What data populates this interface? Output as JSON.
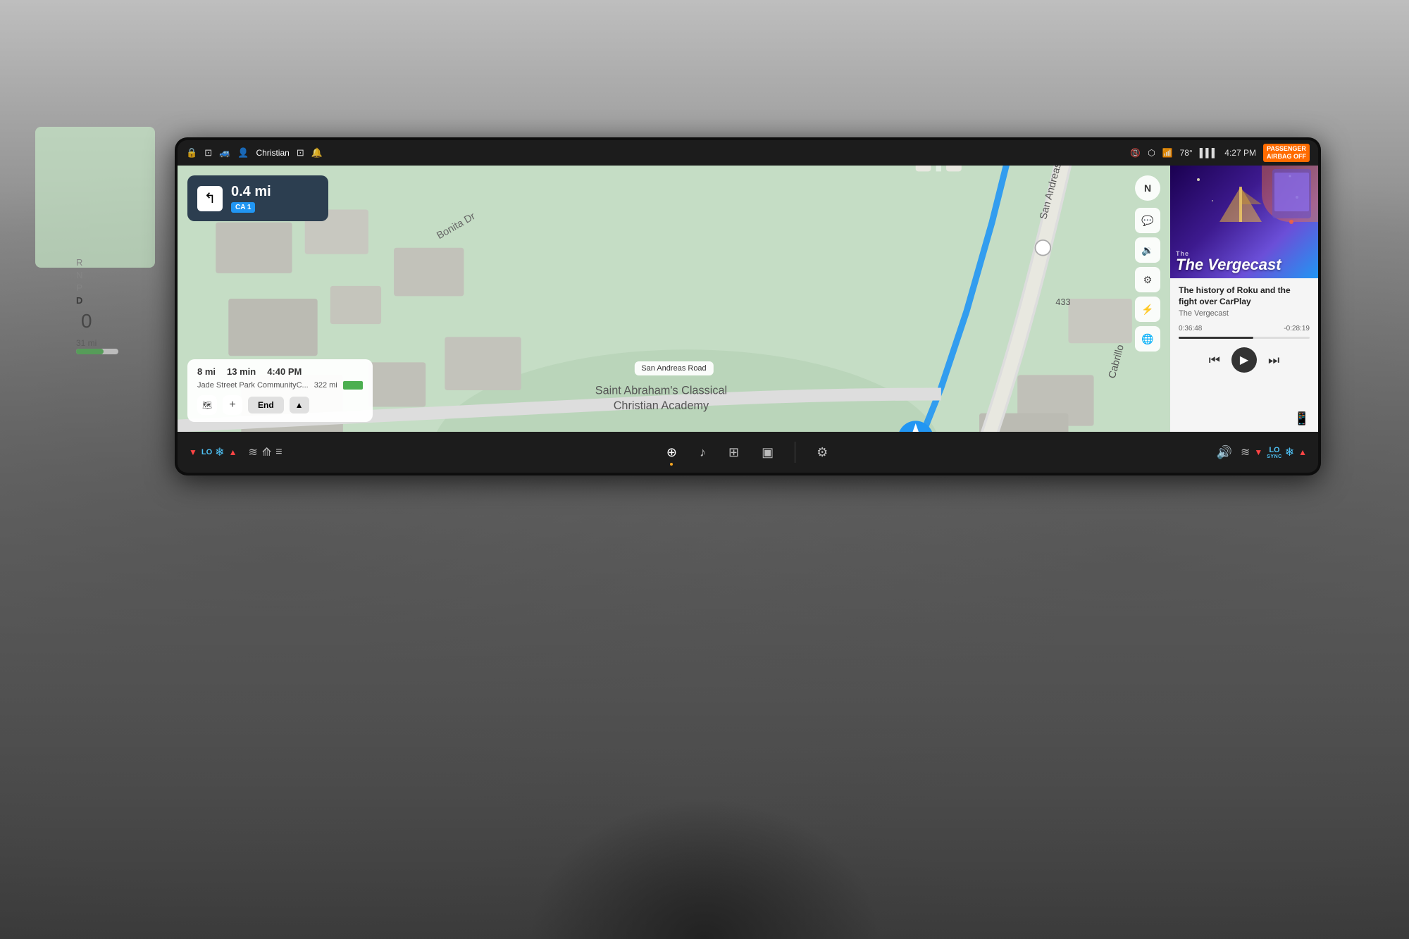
{
  "car": {
    "background": "dashboard"
  },
  "statusBar": {
    "lockIcon": "🔒",
    "copyIcon": "📋",
    "carIcon": "🚗",
    "userName": "Christian",
    "profileIcon": "👤",
    "alertIcon": "🔔",
    "wifiOff": "📶",
    "bluetooth": "⬡",
    "wifiSlash": "📡",
    "temperature": "78°",
    "signal": "📶",
    "time": "4:27 PM",
    "airbagLine1": "PASSENGER",
    "airbagLine2": "AIRBAG OFF"
  },
  "navigation": {
    "distance": "0.4 mi",
    "roadBadge": "CA 1",
    "turnDirection": "↰",
    "northLabel": "N",
    "streetLabel": "San Andreas Road",
    "routeColor": "#2196F3",
    "mapBg": "#b8d4b0"
  },
  "tripPanel": {
    "distance": "8 mi",
    "duration": "13 min",
    "eta": "4:40 PM",
    "destination": "Jade Street Park CommunityC...",
    "range": "322 mi",
    "endButtonLabel": "End",
    "routeIconLabel": "🗺",
    "addLabel": "+"
  },
  "mapControls": {
    "chatIcon": "💬",
    "volumeIcon": "🔉",
    "settingsIcon": "⚙",
    "flashIcon": "⚡",
    "globeIcon": "🌐"
  },
  "media": {
    "showCover": true,
    "showTitle": "The Vergecast",
    "showSubtitle": "The Vergecast",
    "episodeTitle": "The history of Roku and the fight over CarPlay",
    "showName": "The Vergecast",
    "timeElapsed": "0:36:48",
    "timeRemaining": "-0:28:19",
    "progressPercent": 57,
    "prevIcon": "⏮",
    "playIcon": "▶",
    "nextIcon": "⏭",
    "phoneIcon": "📱"
  },
  "bottomToolbar": {
    "leftFanSpeed": "LO",
    "leftFanLabel": "LO",
    "leftUpArrow": "▲",
    "leftDownArrow": "▼",
    "seatHeat1": "≋",
    "seatHeat2": "≋",
    "seatHeat3": "≋",
    "navIcon": "⊕",
    "musicIcon": "♪",
    "appsIcon": "⊞",
    "cameraIcon": "▣",
    "divider": "|",
    "settingsIcon": "⚙",
    "volumeIcon": "🔊",
    "rightSeatHeat": "≋",
    "rightDownArrow": "▼",
    "rightFanSpeed": "LO",
    "rightUpArrow": "▲",
    "syncLabel": "SYNC"
  },
  "leftDisplay": {
    "gearR": "R",
    "gearN": "N",
    "gearP": "P",
    "gearD": "D",
    "activGear": "D",
    "speed": "0",
    "range": "31 mi"
  }
}
